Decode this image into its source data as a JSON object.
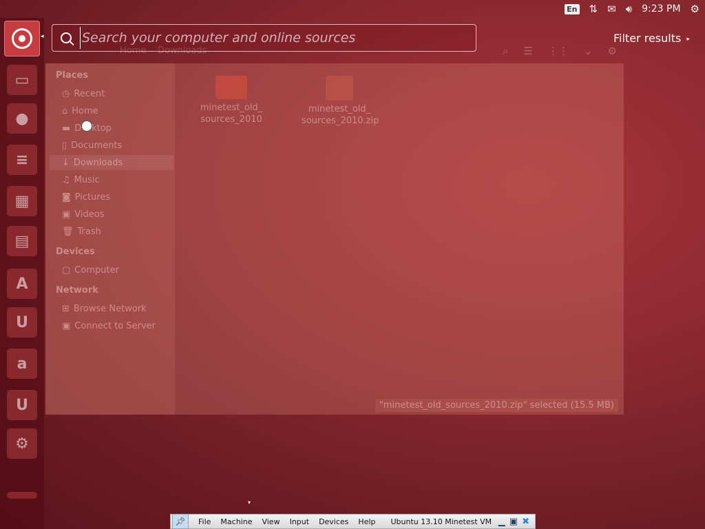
{
  "top_panel": {
    "keyboard": "En",
    "clock": "9:23 PM",
    "icons": [
      "network-icon",
      "mail-icon",
      "volume-icon",
      "system-icon"
    ]
  },
  "dash": {
    "search_placeholder": "Search your computer and online sources",
    "filter_results": "Filter results"
  },
  "file_manager": {
    "breadcrumb": [
      "Home",
      "Downloads"
    ],
    "sidebar": {
      "places_heading": "Places",
      "places": [
        "Recent",
        "Home",
        "Desktop",
        "Documents",
        "Downloads",
        "Music",
        "Pictures",
        "Videos",
        "Trash"
      ],
      "devices_heading": "Devices",
      "devices": [
        "Computer"
      ],
      "network_heading": "Network",
      "network": [
        "Browse Network",
        "Connect to Server"
      ]
    },
    "files": [
      {
        "name_line1": "minetest_old_",
        "name_line2": "sources_2010"
      },
      {
        "name_line1": "minetest_old_",
        "name_line2": "sources_2010.zip"
      }
    ],
    "status": "\"minetest_old_sources_2010.zip\" selected (15.5 MB)"
  },
  "vbox": {
    "menu": [
      "File",
      "Machine",
      "View",
      "Input",
      "Devices",
      "Help"
    ],
    "title": "Ubuntu 13.10 Minetest VM"
  }
}
